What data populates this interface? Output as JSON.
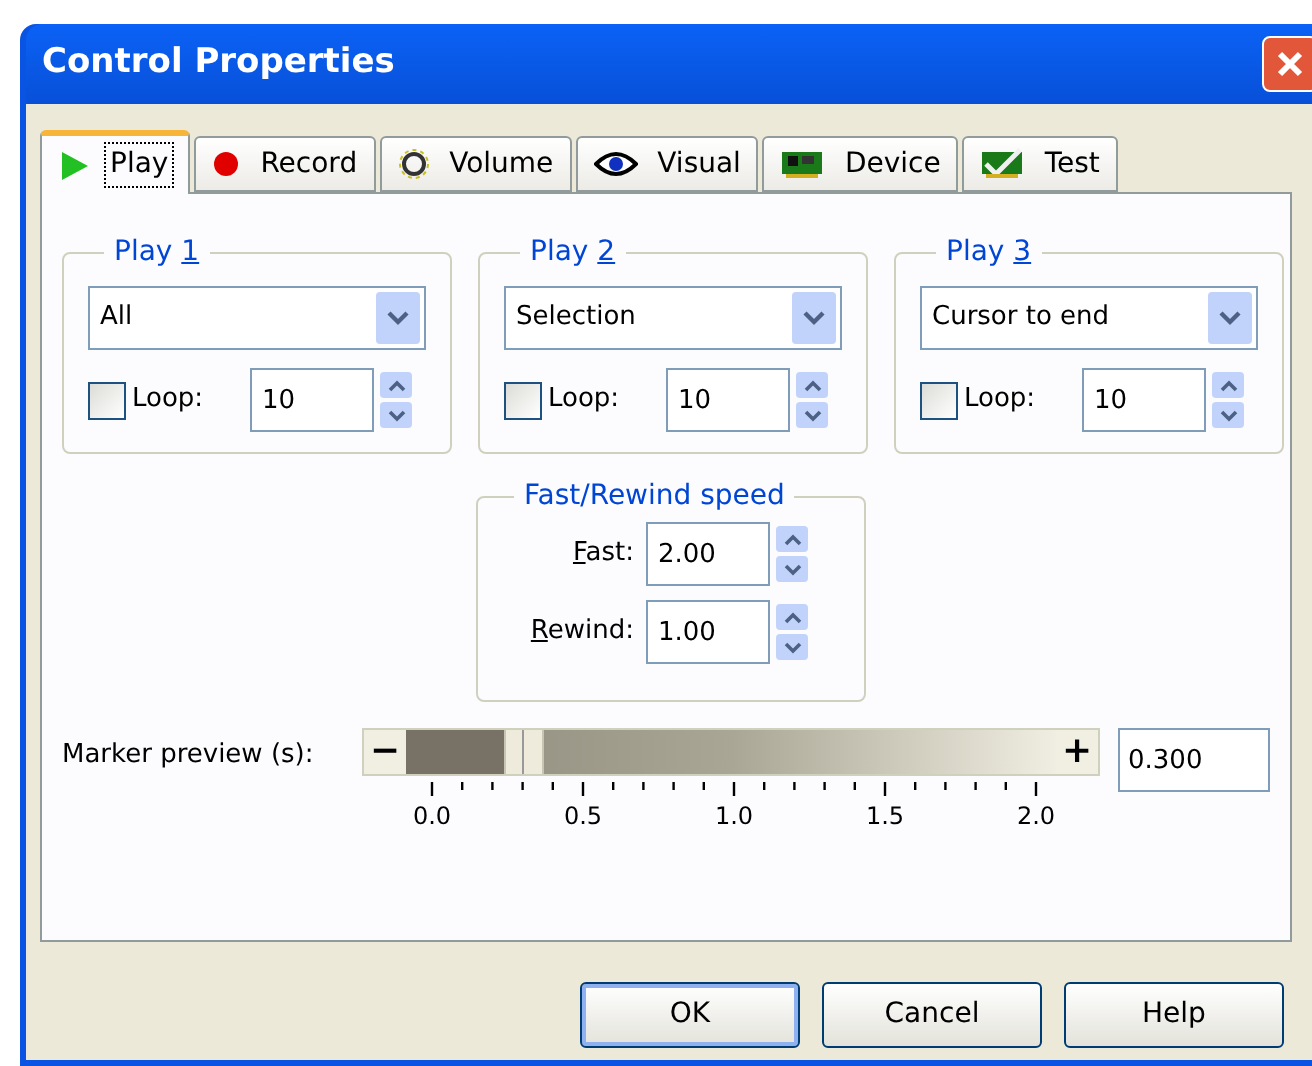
{
  "window": {
    "title": "Control Properties"
  },
  "tabs": [
    {
      "label": "Play",
      "kind": "play",
      "selected": true
    },
    {
      "label": "Record",
      "kind": "record",
      "selected": false
    },
    {
      "label": "Volume",
      "kind": "knob",
      "selected": false
    },
    {
      "label": "Visual",
      "kind": "eye",
      "selected": false
    },
    {
      "label": "Device",
      "kind": "board",
      "selected": false
    },
    {
      "label": "Test",
      "kind": "checkboard",
      "selected": false
    }
  ],
  "play_groups": [
    {
      "prefix": "Play ",
      "key": "1",
      "mode": "All",
      "loop_label": "Loop:",
      "loop": false,
      "count": "10"
    },
    {
      "prefix": "Play ",
      "key": "2",
      "mode": "Selection",
      "loop_label": "Loop:",
      "loop": false,
      "count": "10"
    },
    {
      "prefix": "Play ",
      "key": "3",
      "mode": "Cursor to end",
      "loop_label": "Loop:",
      "loop": false,
      "count": "10"
    }
  ],
  "speed": {
    "title": "Fast/Rewind speed",
    "fields": [
      {
        "key": "F",
        "suffix": "ast:",
        "value": "2.00"
      },
      {
        "key": "R",
        "suffix": "ewind:",
        "value": "1.00"
      }
    ]
  },
  "marker_preview": {
    "label": "Marker preview (s):",
    "minus": "−",
    "plus": "+",
    "level": 0.15,
    "ticks": [
      "0.0",
      "0.5",
      "1.0",
      "1.5",
      "2.0"
    ],
    "value": "0.300"
  },
  "buttons": [
    {
      "label": "OK",
      "default": true
    },
    {
      "label": "Cancel",
      "default": false
    },
    {
      "label": "Help",
      "default": false
    }
  ]
}
